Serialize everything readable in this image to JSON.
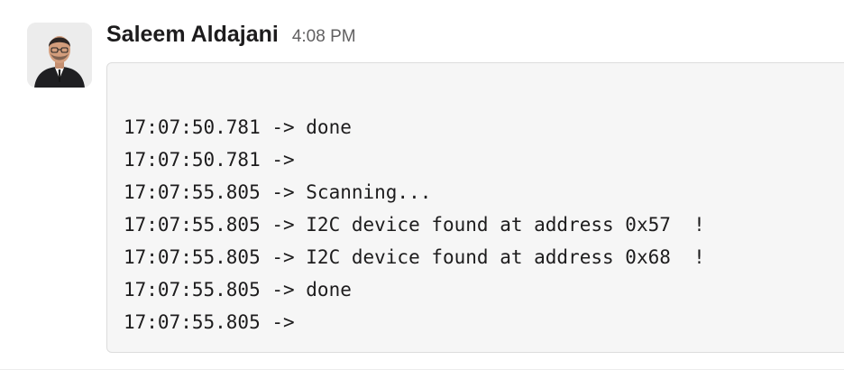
{
  "message": {
    "sender": "Saleem Aldajani",
    "timestamp": "4:08 PM",
    "avatar_icon": "user-avatar",
    "code_lines": [
      "17:07:50.781 -> done",
      "17:07:50.781 ->",
      "17:07:55.805 -> Scanning...",
      "17:07:55.805 -> I2C device found at address 0x57  !",
      "17:07:55.805 -> I2C device found at address 0x68  !",
      "17:07:55.805 -> done",
      "17:07:55.805 ->"
    ]
  },
  "colors": {
    "text": "#1d1c1d",
    "timestamp": "#616061",
    "code_background": "#f6f6f6",
    "code_border": "#dddddd"
  }
}
